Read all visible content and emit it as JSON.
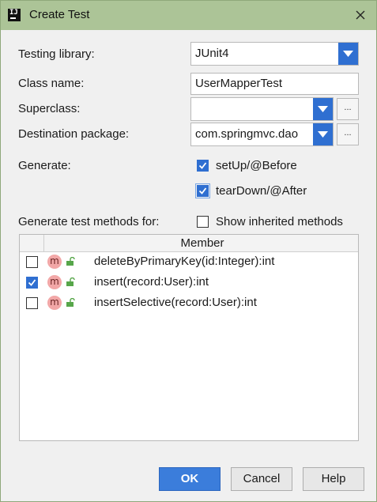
{
  "window": {
    "title": "Create Test",
    "app_icon_text": "IJ"
  },
  "form": {
    "testing_library": {
      "label": "Testing library:",
      "value": "JUnit4"
    },
    "class_name": {
      "label": "Class name:",
      "value": "UserMapperTest"
    },
    "superclass": {
      "label": "Superclass:",
      "value": ""
    },
    "destination_package": {
      "label": "Destination package:",
      "value": "com.springmvc.dao"
    },
    "browse_label": "...",
    "generate": {
      "label": "Generate:",
      "setup": {
        "label": "setUp/@Before",
        "checked": true
      },
      "teardown": {
        "label": "tearDown/@After",
        "checked": true
      }
    },
    "methods_label": "Generate test methods for:",
    "show_inherited": {
      "label": "Show inherited methods",
      "checked": false
    }
  },
  "table": {
    "column_header": "Member",
    "member_icon": "m",
    "rows": [
      {
        "name": "deleteByPrimaryKey(id:Integer):int",
        "checked": false
      },
      {
        "name": "insert(record:User):int",
        "checked": true
      },
      {
        "name": "insertSelective(record:User):int",
        "checked": false
      }
    ]
  },
  "buttons": {
    "ok": "OK",
    "cancel": "Cancel",
    "help": "Help"
  },
  "colors": {
    "accent": "#2f6fd1",
    "titlebar": "#acc497",
    "method_icon": "#f2a7a7"
  },
  "icons": {
    "close": "close-icon",
    "dropdown": "chevron-down-icon",
    "method": "method-icon",
    "access": "unlock-icon"
  }
}
